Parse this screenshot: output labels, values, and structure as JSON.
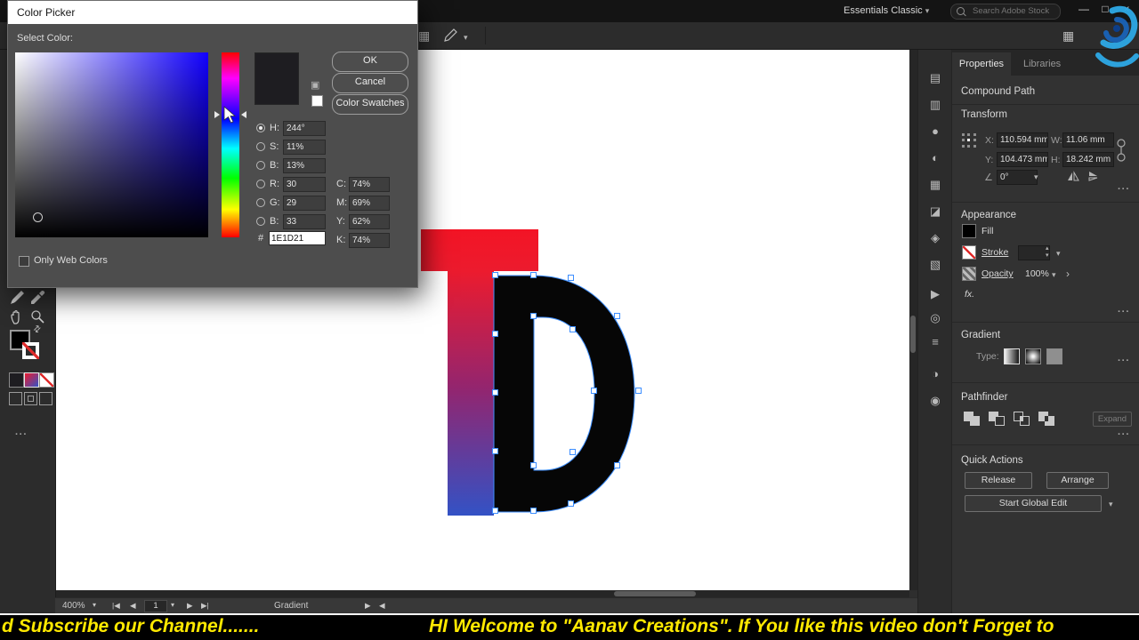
{
  "colors": {
    "selection_blue": "#3d8eff",
    "art_red": "#ec1b2e",
    "art_mid": "#93256f",
    "art_blue": "#3352c5",
    "ticker_yellow": "#ffe900",
    "picker_hue_blue": "#1100ff",
    "current_color": "#1e1d21",
    "d_black": "#060606",
    "logo_light": "#2ea9e6",
    "logo_dark": "#1a63b8"
  },
  "app": {
    "titlebar": {
      "workspace": "Essentials Classic",
      "search_placeholder": "Search Adobe Stock",
      "minimize": "—",
      "maximize": "□",
      "close": "×"
    },
    "ticker": {
      "left": "d Subscribe our Channel.......",
      "right": "HI Welcome to \"Aanav Creations\". If You like this video don't Forget to"
    }
  },
  "glyphs": {
    "chevron_down": "▾",
    "chevron_up": "▴",
    "angle": "∠",
    "arrow_right": "›",
    "more": "···",
    "first": "|◀",
    "prev": "◀",
    "next": "▶",
    "last": "▶|",
    "play": "▶",
    "back": "◀",
    "swap": "⇄",
    "grid": "▦",
    "pen_dropdown": "▾",
    "app_grid": "▦",
    "swatch_options": "▣"
  },
  "dialog": {
    "title": "Color Picker",
    "select_label": "Select Color:",
    "buttons": {
      "ok": "OK",
      "cancel": "Cancel",
      "swatches": "Color Swatches"
    },
    "hsb": {
      "h_label": "H:",
      "h": "244°",
      "s_label": "S:",
      "s": "11%",
      "b_label": "B:",
      "b": "13%"
    },
    "rgb": {
      "r_label": "R:",
      "r": "30",
      "g_label": "G:",
      "g": "29",
      "b_label": "B:",
      "b": "33"
    },
    "cmyk": {
      "c_label": "C:",
      "c": "74%",
      "m_label": "M:",
      "m": "69%",
      "y_label": "Y:",
      "y": "62%",
      "k_label": "K:",
      "k": "74%"
    },
    "hex_label": "#",
    "hex": "1E1D21",
    "only_web": "Only Web Colors"
  },
  "statusbar": {
    "zoom": "400%",
    "artboard": "1",
    "status": "Gradient"
  },
  "panel_strip": {
    "icons": [
      {
        "name": "artboards",
        "glyph": "▤"
      },
      {
        "name": "libraries",
        "glyph": "▥"
      },
      {
        "name": "color",
        "glyph": "●"
      },
      {
        "name": "color-guide",
        "glyph": "◐"
      },
      {
        "name": "swatches",
        "glyph": "▦"
      },
      {
        "name": "brushes",
        "glyph": "◪"
      },
      {
        "name": "symbols",
        "glyph": "◈"
      },
      {
        "name": "layers",
        "glyph": "▧"
      },
      {
        "name": "comments",
        "glyph": "▶"
      },
      {
        "name": "links",
        "glyph": "◎"
      },
      {
        "name": "align",
        "glyph": "≡"
      },
      {
        "name": "gradient-panel",
        "glyph": "◑"
      },
      {
        "name": "history",
        "glyph": "◉"
      }
    ]
  },
  "properties": {
    "tabs": {
      "properties": "Properties",
      "libraries": "Libraries"
    },
    "selection_type": "Compound Path",
    "transform": {
      "heading": "Transform",
      "x_label": "X:",
      "x_value": "110.594 mm",
      "w_label": "W:",
      "w_value": "11.06 mm",
      "y_label": "Y:",
      "y_value": "104.473 mm",
      "h_label": "H:",
      "h_value": "18.242 mm",
      "angle_value": "0°"
    },
    "appearance": {
      "heading": "Appearance",
      "fill_label": "Fill",
      "stroke_label": "Stroke",
      "opacity_label": "Opacity",
      "opacity_value": "100%",
      "fx_label": "fx."
    },
    "gradient": {
      "heading": "Gradient",
      "type_label": "Type:"
    },
    "pathfinder": {
      "heading": "Pathfinder",
      "expand_label": "Expand"
    },
    "quick_actions": {
      "heading": "Quick Actions",
      "release": "Release",
      "arrange": "Arrange",
      "start_global_edit": "Start Global Edit"
    }
  }
}
